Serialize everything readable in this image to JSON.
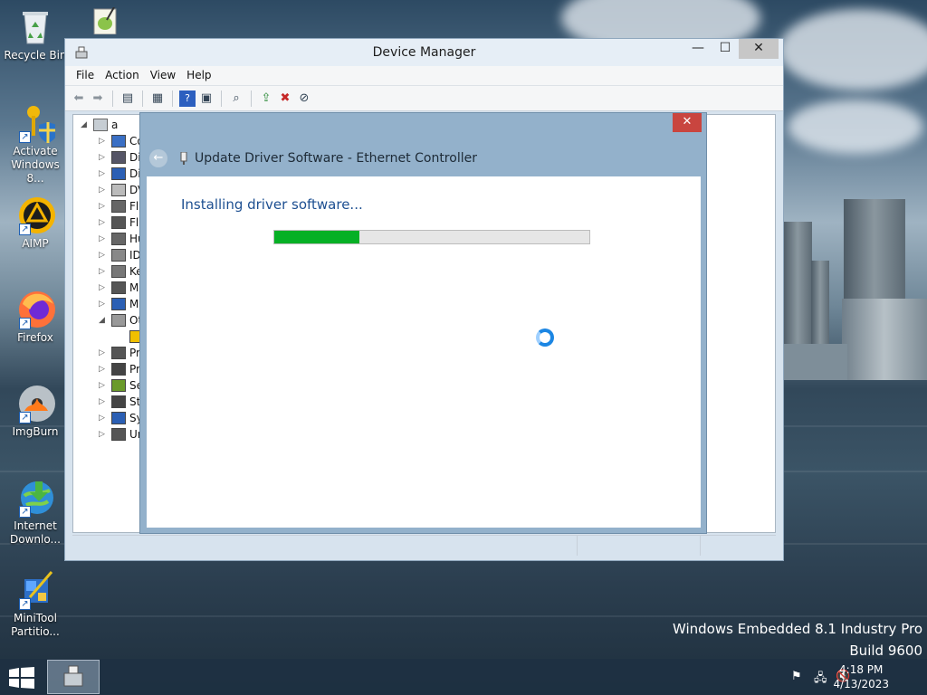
{
  "desktop": {
    "icons": [
      {
        "name": "recycle-bin",
        "label": "Recycle Bin"
      },
      {
        "name": "activate-windows",
        "label": "Activate Windows 8..."
      },
      {
        "name": "aimp",
        "label": "AIMP"
      },
      {
        "name": "firefox",
        "label": "Firefox"
      },
      {
        "name": "imgburn",
        "label": "ImgBurn"
      },
      {
        "name": "internet-download-manager",
        "label": "Internet Downlo..."
      },
      {
        "name": "minitool-partition",
        "label": "MiniTool Partitio..."
      }
    ],
    "watermark_line1": "Windows Embedded 8.1 Industry Pro",
    "watermark_line2": "Build 9600"
  },
  "device_manager": {
    "title": "Device Manager",
    "menu": [
      "File",
      "Action",
      "View",
      "Help"
    ],
    "toolbar_icons": [
      "back-icon",
      "forward-icon",
      "show-hide-console-tree-icon",
      "properties-icon",
      "help-icon",
      "view-icon",
      "scan-hardware-icon",
      "update-driver-icon",
      "uninstall-icon",
      "disable-device-icon"
    ],
    "tree_root": "a",
    "tree_items": [
      "Co",
      "Di",
      "Di",
      "DV",
      "Fl",
      "Fl",
      "Hu",
      "ID",
      "Ke",
      "M",
      "M",
      "Ot",
      "",
      "Pr",
      "Pr",
      "Se",
      "St",
      "Sy",
      "Ur"
    ]
  },
  "dialog": {
    "title": "Update Driver Software - Ethernet Controller",
    "heading": "Installing driver software...",
    "progress_fraction": 0.27,
    "close_label": "✕",
    "back_label": "←"
  },
  "taskbar": {
    "time": "4:18 PM",
    "date": "4/13/2023"
  },
  "colors": {
    "progress": "#06b025",
    "dialog_frame": "#93b1cb",
    "heading": "#1d4f91",
    "close": "#c9453f"
  }
}
